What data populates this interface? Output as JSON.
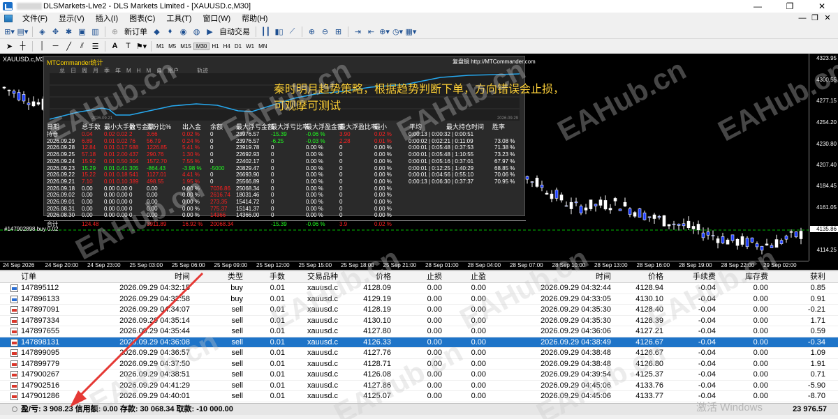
{
  "window": {
    "title": "DLSMarkets-Live2 - DLS Markets Limited - [XAUUSD.c,M30]",
    "buttons": [
      "—",
      "❐",
      "✕"
    ]
  },
  "menu": {
    "items": [
      "文件(F)",
      "显示(V)",
      "插入(I)",
      "图表(C)",
      "工具(T)",
      "窗口(W)",
      "帮助(H)"
    ],
    "mdi": [
      "—",
      "❐",
      "✕"
    ]
  },
  "toolbar": {
    "new_order": "新订单",
    "auto_trade": "自动交易",
    "timeframes": [
      "M1",
      "M5",
      "M15",
      "M30",
      "H1",
      "H4",
      "D1",
      "W1",
      "MN"
    ],
    "active_timeframe": "M30"
  },
  "chart": {
    "symbol": "XAUUSD.c,M30",
    "price_labels": [
      "4323.95",
      "4300.55",
      "4277.15",
      "4254.20",
      "4230.80",
      "4207.40",
      "4184.45",
      "4161.05",
      "4137.65",
      "4114.25"
    ],
    "current_price": "4135.86",
    "time_labels": [
      "24 Sep 2026",
      "24 Sep 20:00",
      "24 Sep 23:00",
      "25 Sep 03:00",
      "25 Sep 06:00",
      "25 Sep 09:00",
      "25 Sep 12:00",
      "25 Sep 15:00",
      "25 Sep 18:00",
      "25 Sep 21:00",
      "28 Sep 01:00",
      "28 Sep 04:00",
      "28 Sep 07:00",
      "28 Sep 10:00",
      "28 Sep 13:00",
      "28 Sep 16:00",
      "28 Sep 19:00",
      "28 Sep 22:00",
      "29 Sep 02:00"
    ],
    "order_label": "#147902898 buy 0.02",
    "colors": {
      "background": "#000000",
      "bull": "#ffffff",
      "bear": "#1a3cff",
      "order_line": "#00c000"
    }
  },
  "mtcommander": {
    "title": "MTCommander统计",
    "tabs": [
      "总",
      "日",
      "周",
      "月",
      "季",
      "年",
      "M",
      "H",
      "M",
      "自",
      "账户",
      "轨迹"
    ],
    "link": "复盘镜  http://MTCommander.com",
    "graph_left_date": "2026.09.21",
    "graph_right_date": "2026.09.29",
    "overlay_text": "秦时明月趋势策略，根据趋势判断下单，方向错误会止损，可观摩可测试",
    "headers": [
      "日期",
      "总手数",
      "最小",
      "大手数",
      "盈亏金额",
      "百分比%",
      "出入金",
      "余额",
      "最大浮亏金额",
      "最大浮亏比率",
      "最大浮盈金额",
      "最大浮盈比率",
      "最小",
      "平均",
      "最大持仓时间",
      "胜率"
    ],
    "rows": [
      {
        "date": "持仓",
        "lots": "0.04",
        "min": "0.02",
        "max": "0.02",
        "n": "2",
        "pl": "3.66",
        "pct": "0.02 %",
        "dep": "0",
        "bal": "23976.57",
        "fl": "-15.39",
        "flp": "-0.06 %",
        "fp": "3.90",
        "fpp": "0.02 %",
        "time": "0:00:13 | 0:00:32 | 0:00:51",
        "win": ""
      },
      {
        "date": "2026.09.29",
        "lots": "6.89",
        "min": "0.01",
        "max": "0.02",
        "n": "76",
        "pl": "56.79",
        "pct": "0.24 %",
        "dep": "0",
        "bal": "23976.57",
        "fl": "-6.25",
        "flp": "-0.03 %",
        "fp": "2.28",
        "fpp": "0.01 %",
        "time": "0:00:02 | 0:02:21 | 0:11:09",
        "win": "73.08 %"
      },
      {
        "date": "2026.09.28",
        "lots": "12.84",
        "min": "0.01",
        "max": "0.17",
        "n": "588",
        "pl": "1226.85",
        "pct": "5.41 %",
        "dep": "0",
        "bal": "23919.78",
        "fl": "0",
        "flp": "0.00 %",
        "fp": "0",
        "fpp": "0.00 %",
        "time": "0:00:01 | 0:05:48 | 0:37:53",
        "win": "71.38 %"
      },
      {
        "date": "2026.09.25",
        "lots": "57.18",
        "min": "0.01",
        "max": "2.00",
        "n": "437",
        "pl": "290.76",
        "pct": "1.30 %",
        "dep": "0",
        "bal": "22692.93",
        "fl": "0",
        "flp": "0.00 %",
        "fp": "0",
        "fpp": "0.00 %",
        "time": "0:00:01 | 0:05:48 | 1:10:55",
        "win": "73.23 %"
      },
      {
        "date": "2026.09.24",
        "lots": "15.92",
        "min": "0.01",
        "max": "0.50",
        "n": "304",
        "pl": "1572.70",
        "pct": "7.55 %",
        "dep": "0",
        "bal": "22402.17",
        "fl": "0",
        "flp": "0.00 %",
        "fp": "0",
        "fpp": "0.00 %",
        "time": "0:00:01 | 0:05:16 | 0:37:01",
        "win": "67.97 %"
      },
      {
        "date": "2026.09.23",
        "lots": "15.29",
        "min": "0.01",
        "max": "0.41",
        "n": "305",
        "pl": "-864.43",
        "pct": "-3.98 %",
        "dep": "-5000",
        "bal": "20829.47",
        "fl": "0",
        "flp": "0.00 %",
        "fp": "0",
        "fpp": "0.00 %",
        "time": "0:00:01 | 0:12:25 | 1:40:29",
        "win": "68.85 %"
      },
      {
        "date": "2026.09.22",
        "lots": "15.22",
        "min": "0.01",
        "max": "0.18",
        "n": "541",
        "pl": "1127.01",
        "pct": "4.41 %",
        "dep": "0",
        "bal": "26693.90",
        "fl": "0",
        "flp": "0.00 %",
        "fp": "0",
        "fpp": "0.00 %",
        "time": "0:00:01 | 0:04:56 | 0:55:10",
        "win": "70.06 %"
      },
      {
        "date": "2026.09.21",
        "lots": "7.10",
        "min": "0.01",
        "max": "0.10",
        "n": "389",
        "pl": "498.55",
        "pct": "1.95 %",
        "dep": "0",
        "bal": "25566.89",
        "fl": "0",
        "flp": "0.00 %",
        "fp": "0",
        "fpp": "0.00 %",
        "time": "0:00:13 | 0:06:30 | 0:37:37",
        "win": "70.95 %"
      },
      {
        "date": "2026.09.18",
        "lots": "0.00",
        "min": "0.00",
        "max": "0.00",
        "n": "0",
        "pl": "0.00",
        "pct": "0.00 %",
        "dep": "7036.86",
        "bal": "25068.34",
        "fl": "0",
        "flp": "0.00 %",
        "fp": "0",
        "fpp": "0.00 %",
        "time": "",
        "win": ""
      },
      {
        "date": "2026.09.02",
        "lots": "0.00",
        "min": "0.00",
        "max": "0.00",
        "n": "0",
        "pl": "0.00",
        "pct": "0.00 %",
        "dep": "2616.74",
        "bal": "18031.46",
        "fl": "0",
        "flp": "0.00 %",
        "fp": "0",
        "fpp": "0.00 %",
        "time": "",
        "win": ""
      },
      {
        "date": "2026.09.01",
        "lots": "0.00",
        "min": "0.00",
        "max": "0.00",
        "n": "0",
        "pl": "0.00",
        "pct": "0.00 %",
        "dep": "273.35",
        "bal": "15414.72",
        "fl": "0",
        "flp": "0.00 %",
        "fp": "0",
        "fpp": "0.00 %",
        "time": "",
        "win": ""
      },
      {
        "date": "2026.08.31",
        "lots": "0.00",
        "min": "0.00",
        "max": "0.00",
        "n": "0",
        "pl": "0.00",
        "pct": "0.00 %",
        "dep": "775.37",
        "bal": "15141.37",
        "fl": "0",
        "flp": "0.00 %",
        "fp": "0",
        "fpp": "0.00 %",
        "time": "",
        "win": ""
      },
      {
        "date": "2026.08.30",
        "lots": "0.00",
        "min": "0.00",
        "max": "0.00",
        "n": "0",
        "pl": "0.00",
        "pct": "0.00 %",
        "dep": "14366",
        "bal": "14366.00",
        "fl": "0",
        "flp": "0.00 %",
        "fp": "0",
        "fpp": "0.00 %",
        "time": "",
        "win": ""
      }
    ],
    "total": {
      "label": "合计",
      "lots": "124.48",
      "pl": "3911.89",
      "pct": "16.92 %",
      "dep": "20068.34",
      "fl": "-15.39",
      "flp": "-0.06 %",
      "fp": "3.9",
      "fpp": "0.02 %"
    }
  },
  "trades": {
    "headers": [
      "订单",
      "时间",
      "类型",
      "手数",
      "交易品种",
      "价格",
      "止损",
      "止盈",
      "时间",
      "价格",
      "手续费",
      "库存费",
      "获利"
    ],
    "rows": [
      {
        "order": "147895112",
        "open": "2026.09.29 04:32:15",
        "type": "buy",
        "lots": "0.01",
        "sym": "xauusd.c",
        "price": "4128.09",
        "sl": "0.00",
        "tp": "0.00",
        "close": "2026.09.29 04:32:44",
        "cprice": "4128.94",
        "fee": "-0.04",
        "swap": "0.00",
        "profit": "0.85"
      },
      {
        "order": "147896133",
        "open": "2026.09.29 04:32:58",
        "type": "buy",
        "lots": "0.01",
        "sym": "xauusd.c",
        "price": "4129.19",
        "sl": "0.00",
        "tp": "0.00",
        "close": "2026.09.29 04:33:05",
        "cprice": "4130.10",
        "fee": "-0.04",
        "swap": "0.00",
        "profit": "0.91"
      },
      {
        "order": "147897091",
        "open": "2026.09.29 04:34:07",
        "type": "sell",
        "lots": "0.01",
        "sym": "xauusd.c",
        "price": "4128.19",
        "sl": "0.00",
        "tp": "0.00",
        "close": "2026.09.29 04:35:30",
        "cprice": "4128.40",
        "fee": "-0.04",
        "swap": "0.00",
        "profit": "-0.21"
      },
      {
        "order": "147897334",
        "open": "2026.09.29 04:35:14",
        "type": "sell",
        "lots": "0.01",
        "sym": "xauusd.c",
        "price": "4130.10",
        "sl": "0.00",
        "tp": "0.00",
        "close": "2026.09.29 04:35:30",
        "cprice": "4128.39",
        "fee": "-0.04",
        "swap": "0.00",
        "profit": "1.71"
      },
      {
        "order": "147897655",
        "open": "2026.09.29 04:35:44",
        "type": "sell",
        "lots": "0.01",
        "sym": "xauusd.c",
        "price": "4127.80",
        "sl": "0.00",
        "tp": "0.00",
        "close": "2026.09.29 04:36:06",
        "cprice": "4127.21",
        "fee": "-0.04",
        "swap": "0.00",
        "profit": "0.59"
      },
      {
        "order": "147898131",
        "open": "2026.09.29 04:36:08",
        "type": "sell",
        "lots": "0.01",
        "sym": "xauusd.c",
        "price": "4126.33",
        "sl": "0.00",
        "tp": "0.00",
        "close": "2026.09.29 04:38:49",
        "cprice": "4126.67",
        "fee": "-0.04",
        "swap": "0.00",
        "profit": "-0.34",
        "selected": true
      },
      {
        "order": "147899095",
        "open": "2026.09.29 04:36:57",
        "type": "sell",
        "lots": "0.01",
        "sym": "xauusd.c",
        "price": "4127.76",
        "sl": "0.00",
        "tp": "0.00",
        "close": "2026.09.29 04:38:48",
        "cprice": "4126.67",
        "fee": "-0.04",
        "swap": "0.00",
        "profit": "1.09"
      },
      {
        "order": "147899779",
        "open": "2026.09.29 04:37:50",
        "type": "sell",
        "lots": "0.01",
        "sym": "xauusd.c",
        "price": "4128.71",
        "sl": "0.00",
        "tp": "0.00",
        "close": "2026.09.29 04:38:48",
        "cprice": "4126.80",
        "fee": "-0.04",
        "swap": "0.00",
        "profit": "1.91"
      },
      {
        "order": "147900267",
        "open": "2026.09.29 04:38:51",
        "type": "sell",
        "lots": "0.01",
        "sym": "xauusd.c",
        "price": "4126.08",
        "sl": "0.00",
        "tp": "0.00",
        "close": "2026.09.29 04:39:54",
        "cprice": "4125.37",
        "fee": "-0.04",
        "swap": "0.00",
        "profit": "0.71"
      },
      {
        "order": "147902516",
        "open": "2026.09.29 04:41:29",
        "type": "sell",
        "lots": "0.01",
        "sym": "xauusd.c",
        "price": "4127.86",
        "sl": "0.00",
        "tp": "0.00",
        "close": "2026.09.29 04:45:06",
        "cprice": "4133.76",
        "fee": "-0.04",
        "swap": "0.00",
        "profit": "-5.90"
      },
      {
        "order": "147901286",
        "open": "2026.09.29 04:40:01",
        "type": "sell",
        "lots": "0.01",
        "sym": "xauusd.c",
        "price": "4125.07",
        "sl": "0.00",
        "tp": "0.00",
        "close": "2026.09.29 04:45:06",
        "cprice": "4133.77",
        "fee": "-0.04",
        "swap": "0.00",
        "profit": "-8.70"
      }
    ]
  },
  "status": {
    "summary": "盈/亏: 3 908.23  信用额: 0.00  存款: 30 068.34  取款: -10 000.00",
    "total": "23 976.57",
    "activation": "激活 Windows"
  },
  "watermark": "EAHub.cn"
}
